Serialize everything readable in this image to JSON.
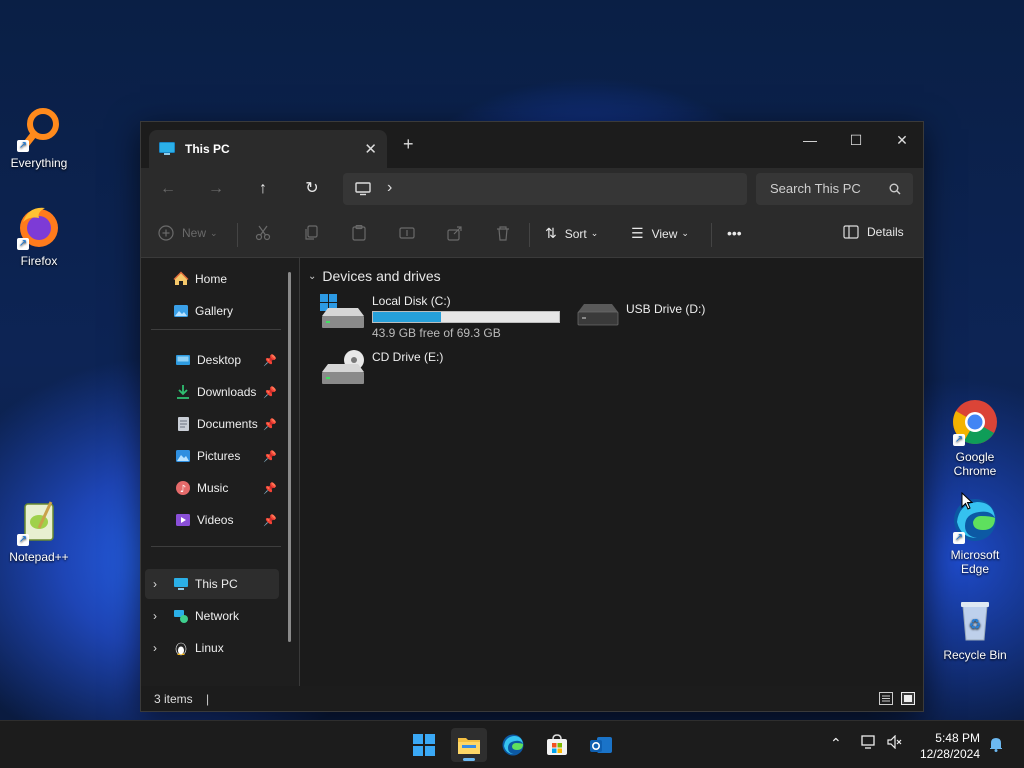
{
  "desktop": {
    "icons": [
      {
        "label": "Everything"
      },
      {
        "label": "Firefox"
      },
      {
        "label": "Notepad++"
      },
      {
        "label": "Google Chrome"
      },
      {
        "label": "Microsoft Edge"
      },
      {
        "label": "Recycle Bin"
      }
    ]
  },
  "window": {
    "tab_title": "This PC",
    "tab_close": "✕",
    "new_tab": "+",
    "controls": {
      "minimize": "—",
      "maximize": "☐",
      "close": "✕"
    },
    "nav": {
      "back": "←",
      "forward": "→",
      "up": "↑",
      "refresh": "↻",
      "chevron": "›"
    },
    "search_placeholder": "Search This PC",
    "toolbar": {
      "new_label": "New",
      "sort_label": "Sort",
      "view_label": "View",
      "more_label": "•••",
      "details_label": "Details"
    },
    "sidebar": {
      "top": [
        {
          "label": "Home"
        },
        {
          "label": "Gallery"
        }
      ],
      "pinned": [
        {
          "label": "Desktop"
        },
        {
          "label": "Downloads"
        },
        {
          "label": "Documents"
        },
        {
          "label": "Pictures"
        },
        {
          "label": "Music"
        },
        {
          "label": "Videos"
        }
      ],
      "bottom": [
        {
          "label": "This PC"
        },
        {
          "label": "Network"
        },
        {
          "label": "Linux"
        }
      ]
    },
    "content": {
      "group_title": "Devices and drives",
      "drives": [
        {
          "name": "Local Disk (C:)",
          "free_text": "43.9 GB free of 69.3 GB",
          "used_fraction": 0.367
        },
        {
          "name": "USB Drive (D:)"
        },
        {
          "name": "CD Drive (E:)"
        }
      ]
    },
    "status": {
      "items": "3 items"
    }
  },
  "taskbar": {
    "time": "5:48 PM",
    "date": "12/28/2024"
  },
  "colors": {
    "accent": "#26a0da",
    "window_bg": "#202020",
    "toolbar_bg": "#2b2b2b",
    "taskbar_bg": "#1c1c1c"
  }
}
